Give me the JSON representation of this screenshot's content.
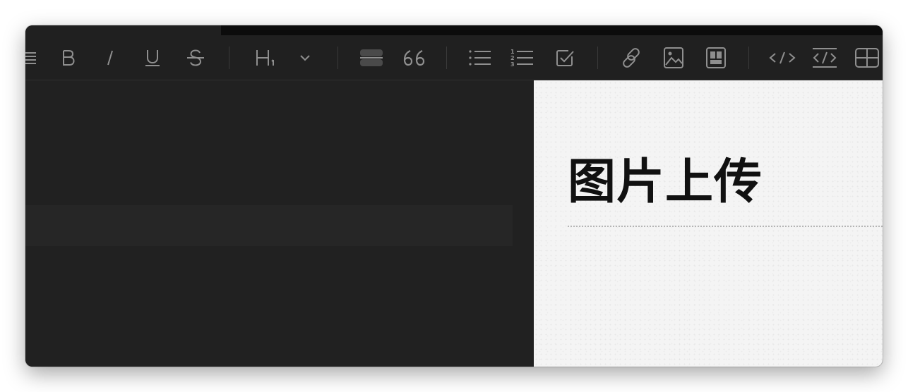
{
  "colors": {
    "toolbar_bg": "#202020",
    "icon": "#8f8f8f",
    "editor_bg": "#212121",
    "preview_bg": "#f4f4f4",
    "heading": "#111111"
  },
  "toolbar": {
    "icons": [
      "menu-icon",
      "bold-icon",
      "italic-icon",
      "underline-icon",
      "strikethrough-icon",
      "heading-icon",
      "chevron-down-icon",
      "horizontal-rule-icon",
      "quote-icon",
      "bulleted-list-icon",
      "numbered-list-icon",
      "task-list-icon",
      "link-icon",
      "image-icon",
      "layout-icon",
      "inline-code-icon",
      "code-block-icon",
      "table-icon"
    ],
    "heading_glyph": "H",
    "heading_sub": "1",
    "quote_glyph": "66",
    "numbered_digits": [
      "1",
      "2",
      "3"
    ]
  },
  "preview": {
    "heading": "图片上传"
  }
}
